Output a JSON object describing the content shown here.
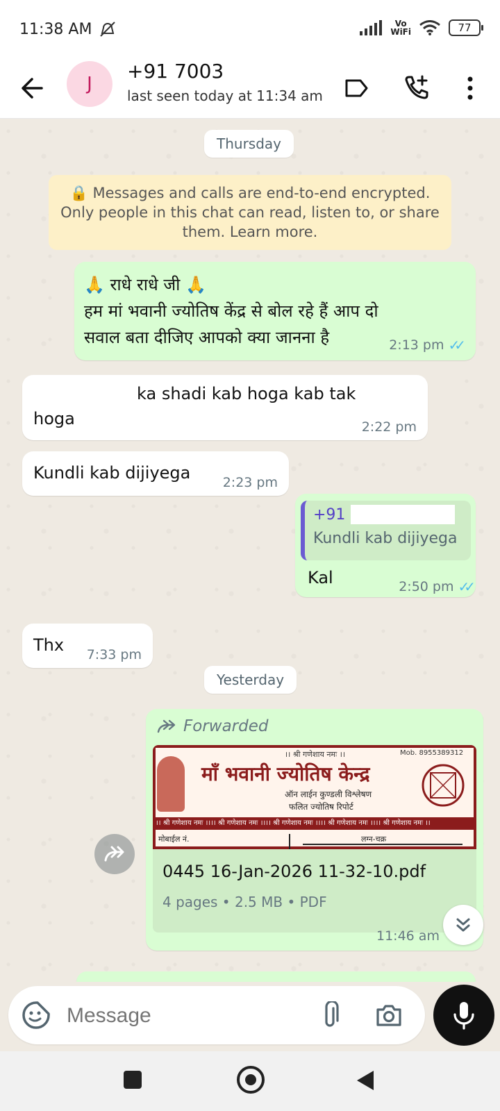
{
  "status_bar": {
    "time": "11:38 AM",
    "vowifi_top": "Vo",
    "vowifi_bottom": "WiFi",
    "battery": "77"
  },
  "header": {
    "avatar_initial": "J",
    "contact_name": "+91 7003",
    "last_seen": "last seen today at 11:34 am"
  },
  "chat": {
    "date_thursday": "Thursday",
    "encryption_notice": "🔒 Messages and calls are end-to-end encrypted. Only people in this chat can read, listen to, or share them. Learn more.",
    "messages": [
      {
        "line1": "🙏 राधे राधे जी 🙏",
        "line2": "हम मां भवानी ज्योतिष केंद्र से बोल रहे हैं आप दो",
        "line3": "सवाल बता दीजिए आपको क्या जानना है",
        "time": "2:13 pm",
        "ticks": "✓✓"
      },
      {
        "line1": "ka shadi kab hoga kab tak",
        "line2": "hoga",
        "time": "2:22 pm"
      },
      {
        "text": "Kundli kab dijiyega",
        "time": "2:23 pm"
      },
      {
        "quote_name": "+91",
        "quote_text": "Kundli kab dijiyega",
        "text": "Kal",
        "time": "2:50 pm",
        "ticks": "✓✓"
      },
      {
        "text": "Thx",
        "time": "7:33 pm"
      }
    ],
    "date_yesterday": "Yesterday",
    "document": {
      "forwarded_label": "Forwarded",
      "thumb_top_line": "।। श्री गणेशाय नमः ।।",
      "thumb_mobile": "Mob. 8955389312",
      "thumb_title": "माँ भवानी ज्योतिष केन्द्र",
      "thumb_sub1": "ऑन लाईन कुण्डली विश्लेषण",
      "thumb_sub2": "फलित ज्योतिष रिपोर्ट",
      "thumb_band": "।। श्री गणेशाय नमः ।।।। श्री गणेशाय नमः ।।।। श्री गणेशाय नमः ।।।। श्री गणेशाय नमः ।।।। श्री गणेशाय नमः ।।",
      "thumb_left_label": "मोबाईल नं.",
      "thumb_right_label": "लग्न-चक्र",
      "file_name": "0445 16-Jan-2026 11-32-10.pdf",
      "file_meta": "4 pages • 2.5 MB • PDF",
      "time": "11:46 am"
    }
  },
  "input": {
    "placeholder": "Message"
  },
  "colors": {
    "outgoing": "#d9fdd3",
    "incoming": "#ffffff",
    "accent": "#53bdeb",
    "quote_bar": "#6b5bd2"
  }
}
